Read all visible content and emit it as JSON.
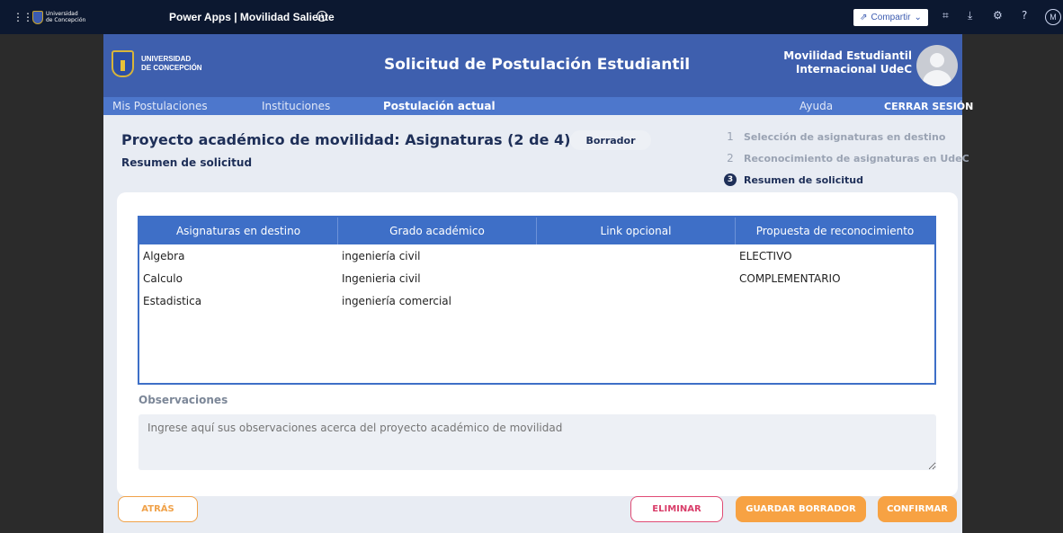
{
  "topbar": {
    "logo_text_line1": "Universidad",
    "logo_text_line2": "de Concepción",
    "app_title": "Power Apps | Movilidad Saliente",
    "share_label": "Compartir",
    "user_initial": "M"
  },
  "header": {
    "logo_line1": "UNIVERSIDAD",
    "logo_line2": "DE CONCEPCIÓN",
    "title": "Solicitud de Postulación Estudiantil",
    "right_line1": "Movilidad Estudiantil",
    "right_line2": "Internacional UdeC"
  },
  "nav": {
    "items": [
      "Mis Postulaciones",
      "Instituciones",
      "Postulación actual"
    ],
    "help": "Ayuda",
    "logout": "CERRAR SESIÓN"
  },
  "page": {
    "title": "Proyecto académico de movilidad: Asignaturas (2 de 4)",
    "subtitle": "Resumen de solicitud",
    "badge": "Borrador"
  },
  "steps": [
    {
      "num": "1",
      "label": "Selección de asignaturas en destino"
    },
    {
      "num": "2",
      "label": "Reconocimiento de asignaturas en UdeC"
    },
    {
      "num": "3",
      "label": "Resumen de solicitud"
    }
  ],
  "table": {
    "headers": [
      "Asignaturas en destino",
      "Grado académico",
      "Link opcional",
      "Propuesta de reconocimiento"
    ],
    "rows": [
      [
        "Algebra",
        "ingeniería civil",
        "",
        "ELECTIVO"
      ],
      [
        "Calculo",
        "Ingenieria civil",
        "",
        "COMPLEMENTARIO"
      ],
      [
        "Estadistica",
        "ingeniería comercial",
        "",
        ""
      ]
    ]
  },
  "observations": {
    "label": "Observaciones",
    "placeholder": "Ingrese aquí sus observaciones acerca del proyecto académico de movilidad"
  },
  "buttons": {
    "back": "ATRÁS",
    "delete": "ELIMINAR",
    "save_draft": "GUARDAR BORRADOR",
    "confirm": "CONFIRMAR"
  },
  "colors": {
    "header": "#3e5fae",
    "nav": "#4d77cc",
    "accent_orange": "#f7a243",
    "delete_pink": "#e04a74",
    "table_header": "#3e6fc7"
  }
}
